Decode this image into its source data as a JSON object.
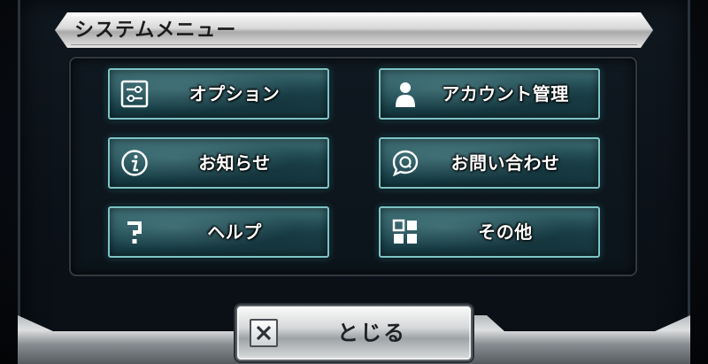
{
  "header": {
    "title": "システムメニュー"
  },
  "menu": {
    "items": [
      {
        "id": "options",
        "label": "オプション",
        "icon": "options-sliders-icon"
      },
      {
        "id": "account",
        "label": "アカウント管理",
        "icon": "user-icon"
      },
      {
        "id": "news",
        "label": "お知らせ",
        "icon": "info-icon"
      },
      {
        "id": "contact",
        "label": "お問い合わせ",
        "icon": "support-chat-icon"
      },
      {
        "id": "help",
        "label": "ヘルプ",
        "icon": "question-icon"
      },
      {
        "id": "other",
        "label": "その他",
        "icon": "grid-icon"
      }
    ]
  },
  "footer": {
    "close_label": "とじる",
    "close_icon": "close-x-icon"
  },
  "colors": {
    "button_face": "#2b5a62",
    "button_border": "#7fc3c6",
    "title_text": "#1c1c1c",
    "label_text": "#ffffff"
  }
}
